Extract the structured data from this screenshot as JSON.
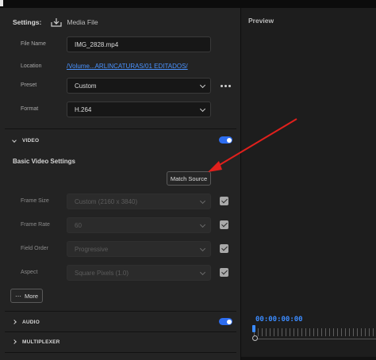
{
  "header": {
    "settings_label": "Settings:",
    "media_file_label": "Media File"
  },
  "fields": {
    "file_name": {
      "label": "File Name",
      "value": "IMG_2828.mp4"
    },
    "location": {
      "label": "Location",
      "value": "/Volume...ARLINCATURAS/01 EDITADOS/"
    },
    "preset": {
      "label": "Preset",
      "value": "Custom"
    },
    "format": {
      "label": "Format",
      "value": "H.264"
    }
  },
  "sections": {
    "video": {
      "title": "VIDEO",
      "enabled": true
    },
    "audio": {
      "title": "AUDIO",
      "enabled": true
    },
    "multiplexer": {
      "title": "MULTIPLEXER"
    }
  },
  "basic_video": {
    "title": "Basic Video Settings",
    "match_source_label": "Match Source",
    "rows": [
      {
        "label": "Frame Size",
        "value": "Custom (2160 x 3840)",
        "checked": true
      },
      {
        "label": "Frame Rate",
        "value": "60",
        "checked": true
      },
      {
        "label": "Field Order",
        "value": "Progressive",
        "checked": true
      },
      {
        "label": "Aspect",
        "value": "Square Pixels (1.0)",
        "checked": true
      }
    ],
    "more_label": "More"
  },
  "preview": {
    "title": "Preview",
    "timecode": "00:00:00:00"
  },
  "colors": {
    "accent": "#2d6df0",
    "link": "#4a93ff",
    "annotation_arrow": "#e0201c"
  }
}
